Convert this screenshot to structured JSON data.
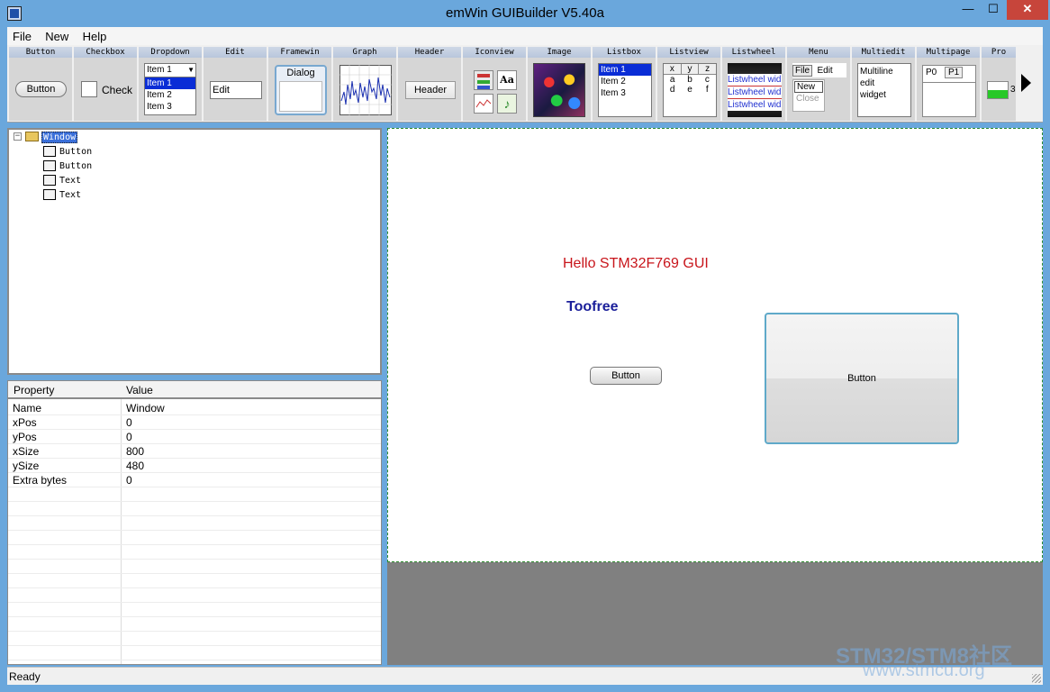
{
  "window": {
    "title": "emWin GUIBuilder V5.40a",
    "min_symbol": "—",
    "max_symbol": "☐",
    "close_symbol": "✕"
  },
  "menu": [
    "File",
    "New",
    "Help"
  ],
  "toolbar": {
    "button": {
      "label": "Button",
      "preview": "Button"
    },
    "checkbox": {
      "label": "Checkbox",
      "preview": "Check"
    },
    "dropdown": {
      "label": "Dropdown",
      "selected": "Item 1",
      "items": [
        "Item 1",
        "Item 2",
        "Item 3"
      ]
    },
    "edit": {
      "label": "Edit",
      "preview": "Edit"
    },
    "framewin": {
      "label": "Framewin",
      "preview": "Dialog"
    },
    "graph": {
      "label": "Graph"
    },
    "header": {
      "label": "Header",
      "preview": "Header"
    },
    "iconview": {
      "label": "Iconview",
      "text_icon": "Aa"
    },
    "image": {
      "label": "Image"
    },
    "listbox": {
      "label": "Listbox",
      "items": [
        "Item 1",
        "Item 2",
        "Item 3"
      ]
    },
    "listview": {
      "label": "Listview",
      "headers": [
        "x",
        "y",
        "z"
      ],
      "rows": [
        [
          "a",
          "b",
          "c"
        ],
        [
          "d",
          "e",
          "f"
        ]
      ]
    },
    "listwheel": {
      "label": "Listwheel",
      "items": [
        "Listwheel wid",
        "Listwheel wid",
        "Listwheel wid"
      ]
    },
    "menu": {
      "label": "Menu",
      "file": "File",
      "edit": "Edit",
      "new": "New",
      "close": "Close"
    },
    "multiedit": {
      "label": "Multiedit",
      "lines": [
        "Multiline",
        "edit",
        "widget"
      ]
    },
    "multipage": {
      "label": "Multipage",
      "tabs": [
        "P0",
        "P1"
      ]
    },
    "progbar": {
      "label": "Pro",
      "value_text": "3"
    }
  },
  "tree": {
    "root": "Window",
    "children": [
      "Button",
      "Button",
      "Text",
      "Text"
    ]
  },
  "properties": {
    "header_property": "Property",
    "header_value": "Value",
    "rows": [
      {
        "name": "Name",
        "value": "Window"
      },
      {
        "name": "xPos",
        "value": "0"
      },
      {
        "name": "yPos",
        "value": "0"
      },
      {
        "name": "xSize",
        "value": "800"
      },
      {
        "name": "ySize",
        "value": "480"
      },
      {
        "name": "Extra bytes",
        "value": "0"
      }
    ]
  },
  "canvas": {
    "hello_text": "Hello STM32F769 GUI",
    "hello_color": "#c8151b",
    "toofree_text": "Toofree",
    "toofree_color": "#1b1f9a",
    "button_small": "Button",
    "button_large": "Button"
  },
  "status": "Ready",
  "watermark": {
    "line1": "STM32/STM8社区",
    "line2": "www.stmcu.org"
  }
}
